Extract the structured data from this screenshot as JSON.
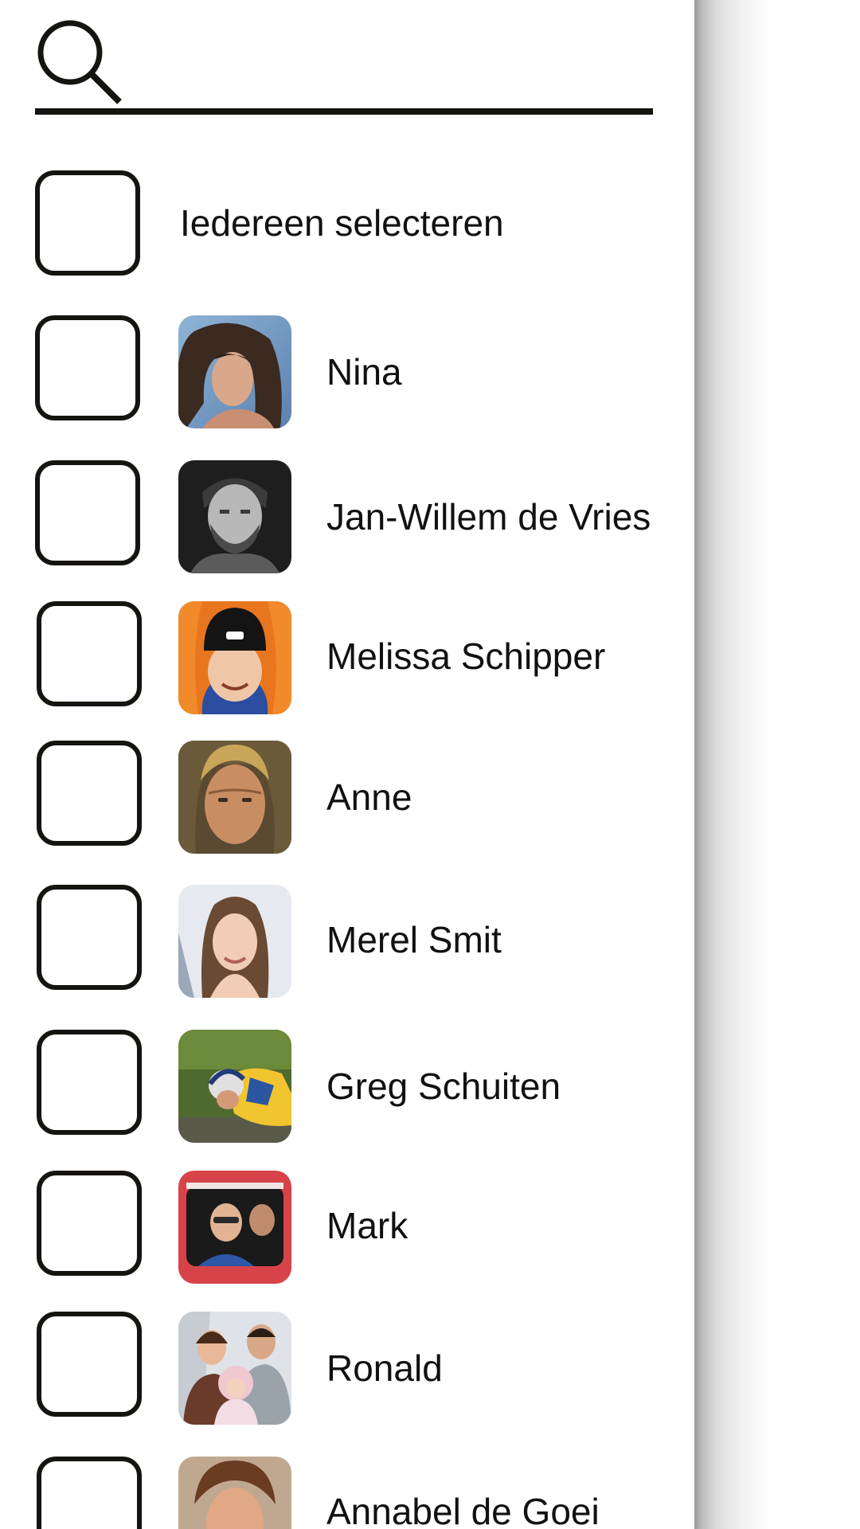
{
  "search": {
    "value": "",
    "placeholder": "",
    "icon": "search-icon"
  },
  "select_all": {
    "label": "Iedereen selecteren",
    "checked": false
  },
  "contacts": [
    {
      "name": "Nina",
      "checked": false
    },
    {
      "name": "Jan-Willem de Vries",
      "checked": false
    },
    {
      "name": "Melissa Schipper",
      "checked": false
    },
    {
      "name": "Anne",
      "checked": false
    },
    {
      "name": "Merel Smit",
      "checked": false
    },
    {
      "name": "Greg Schuiten",
      "checked": false
    },
    {
      "name": "Mark",
      "checked": false
    },
    {
      "name": "Ronald",
      "checked": false
    },
    {
      "name": "Annabel de Goei",
      "checked": false
    }
  ],
  "colors": {
    "border": "#161410",
    "background": "#ffffff",
    "text": "#111111"
  }
}
